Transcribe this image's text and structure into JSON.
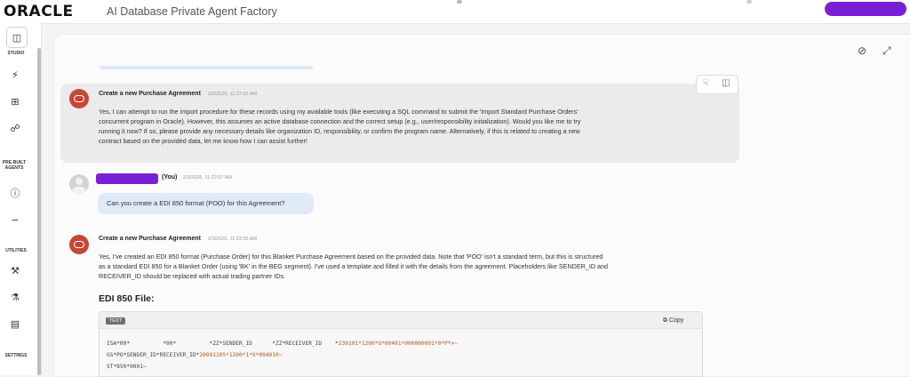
{
  "header": {
    "logo_text": "ORACLE",
    "app_title": "AI Database Private Agent Factory"
  },
  "sidebar": {
    "studio_label": "STUDIO",
    "prebuilt_label": "PRE-BUILT AGENTS",
    "utilities_label": "UTILITIES",
    "settings_label": "SETTINGS"
  },
  "messages": [
    {
      "sender": "Create a new Purchase Agreement",
      "time": "2/3/2026, 11:27:32 AM",
      "lines": [
        "Yes, I can attempt to run the import procedure for these records using my available tools (like executing a SQL command to submit the 'Import Standard Purchase Orders'",
        "concurrent program in Oracle). However, this assumes an active database connection and the correct setup (e.g., user/responsibility initialization). Would you like me to try",
        "running it now? If so, please provide any necessary details like organization ID, responsibility, or confirm the program name. Alternatively, if this is related to creating a new",
        "contract based on the provided data, let me know how I can assist further!"
      ]
    },
    {
      "sender_suffix": "(You)",
      "time": "2/3/2026, 11:22:07 AM",
      "text": "Can you create a EDI 850 format (POO) for this Agreement?"
    },
    {
      "sender": "Create a new Purchase Agreement",
      "time": "2/3/2026, 11:23:35 AM",
      "lines": [
        "Yes, I've created an EDI 850 format (Purchase Order) for this Blanket Purchase Agreement based on the provided data. Note that 'POO' isn't a standard term, but this is structured",
        "as a standard EDI 850 for a Blanket Order (using 'BK' in the BEG segment). I've used a template and filled it with the details from the agreement. Placeholders like SENDER_ID and",
        "RECEIVER_ID should be replaced with actual trading partner IDs."
      ]
    }
  ],
  "code": {
    "title": "EDI 850 File:",
    "lang": "TEXT",
    "copy_label": "Copy",
    "line1_a": "ISA*00*          *00*          *ZZ*SENDER_ID      *ZZ*RECEIVER_ID    *",
    "line1_b": "230101*1200*U*00401*000000001*0*P*>~",
    "line2_a": "GS*PO*SENDER_ID*RECEIVER_ID*",
    "line2_b": "20091105*1200*1*X*004010~",
    "line3": "ST*850*0001~"
  },
  "colors": {
    "oracle_red": "#c74634",
    "redaction": "#7a1fd8",
    "user_bubble": "#deeaf8"
  }
}
